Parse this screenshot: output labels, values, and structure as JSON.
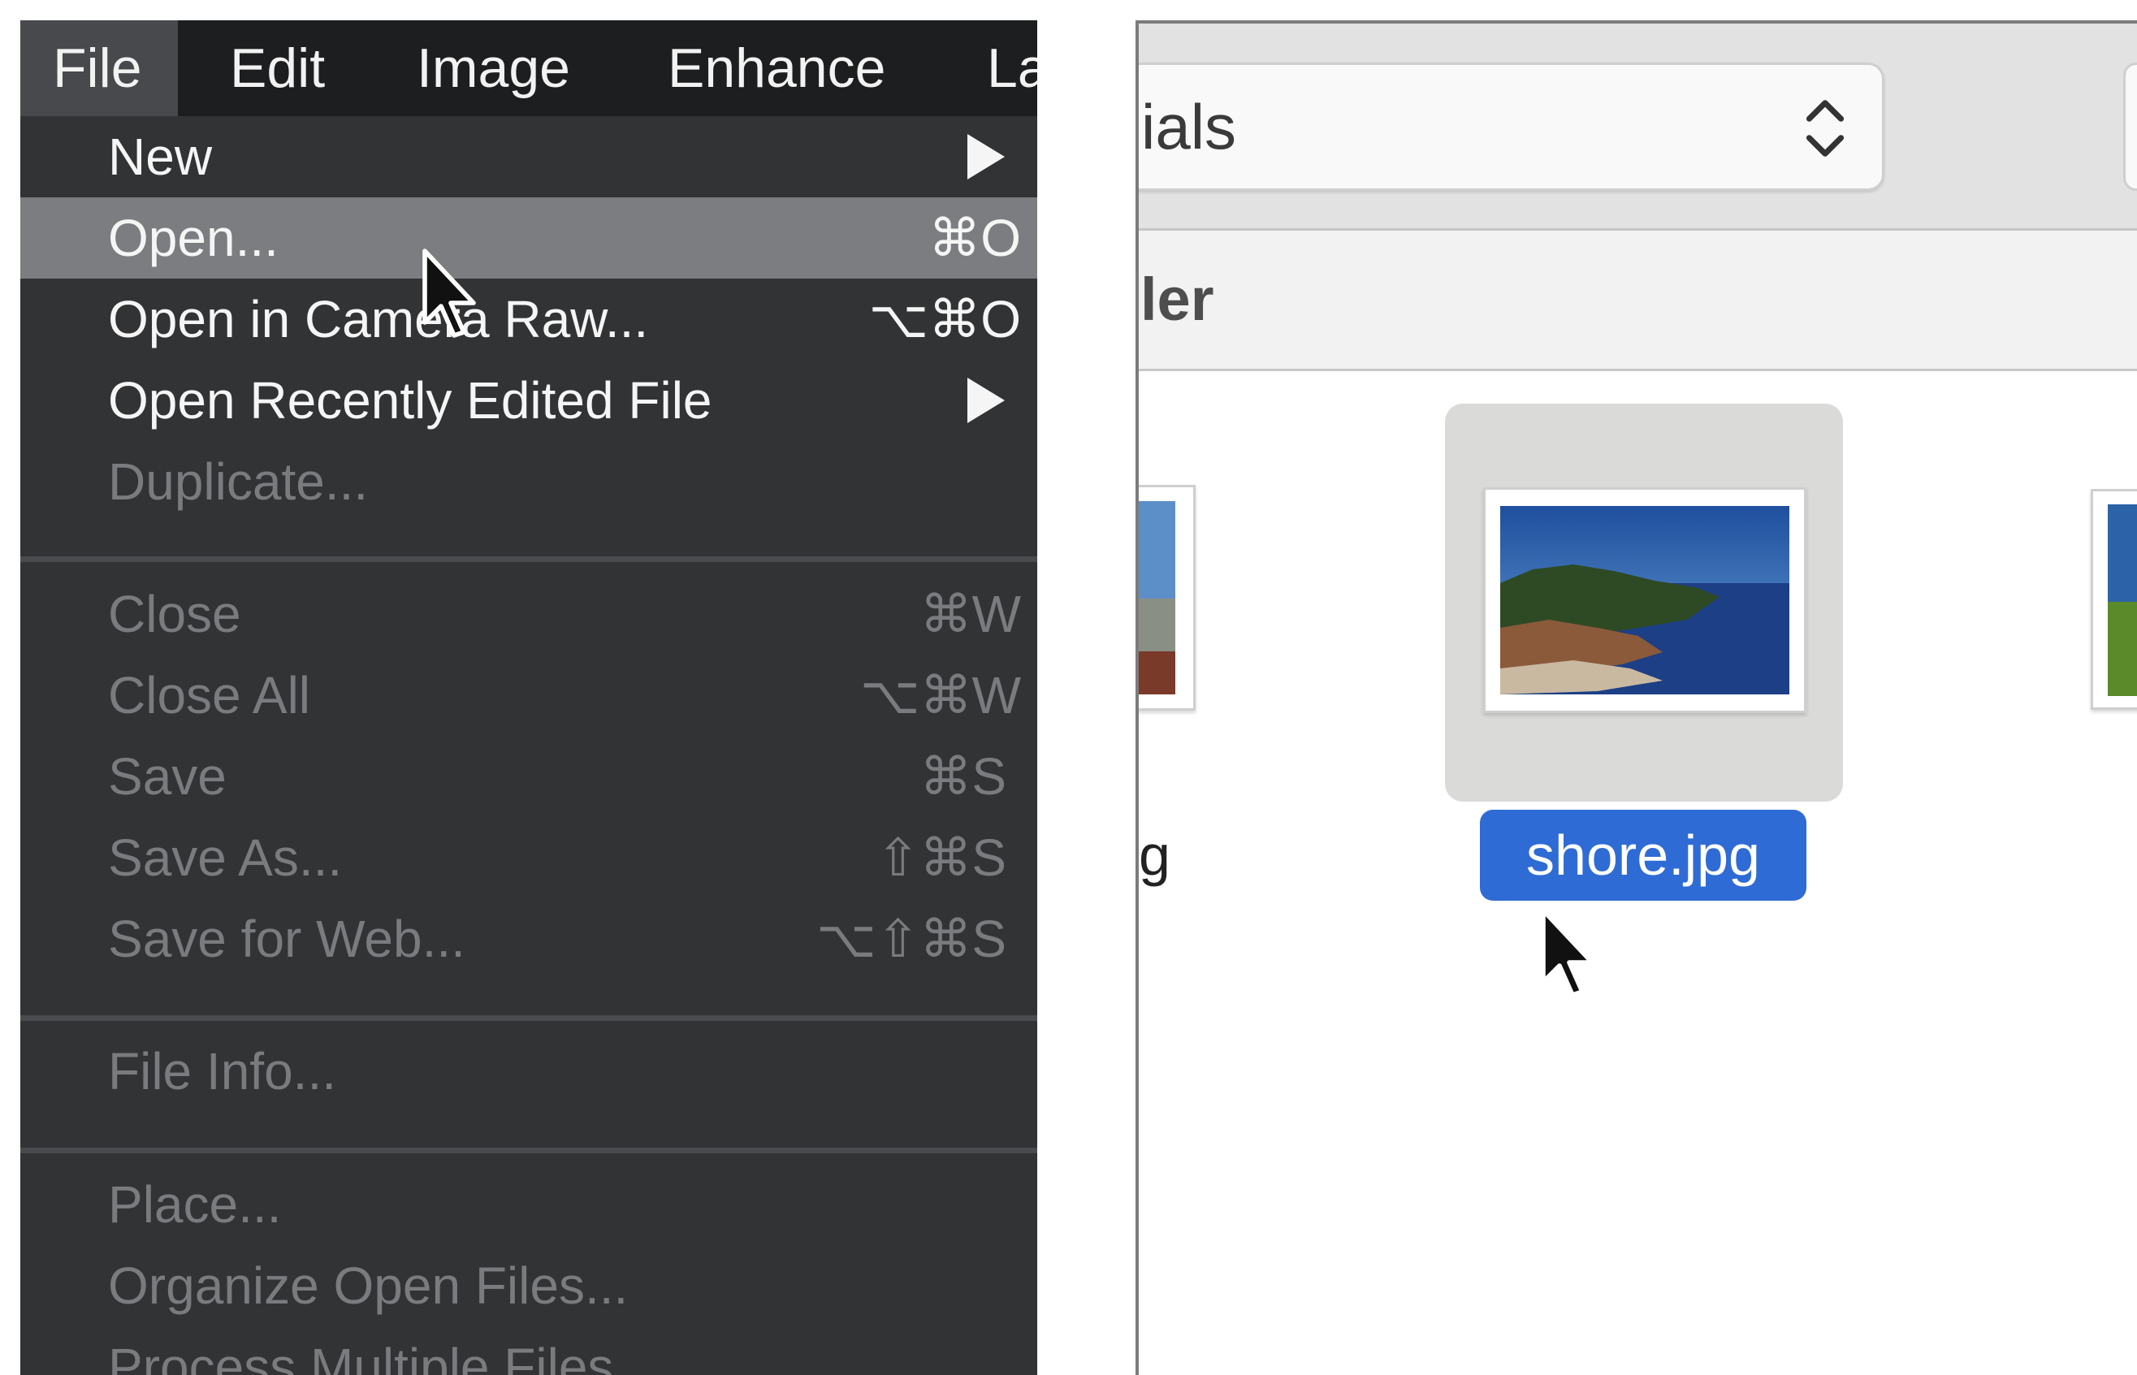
{
  "menubar": {
    "items": [
      "File",
      "Edit",
      "Image",
      "Enhance",
      "La"
    ],
    "active": "File"
  },
  "file_menu": {
    "items": [
      {
        "label": "New",
        "shortcut": "",
        "submenu": true,
        "enabled": true,
        "highlighted": false
      },
      {
        "label": "Open...",
        "shortcut": "⌘O",
        "submenu": false,
        "enabled": true,
        "highlighted": true
      },
      {
        "label": "Open in Camera Raw...",
        "shortcut": "⌥⌘O",
        "submenu": false,
        "enabled": true,
        "highlighted": false
      },
      {
        "label": "Open Recently Edited File",
        "shortcut": "",
        "submenu": true,
        "enabled": true,
        "highlighted": false
      },
      {
        "label": "Duplicate...",
        "shortcut": "",
        "submenu": false,
        "enabled": false,
        "highlighted": false
      },
      {
        "label": "Close",
        "shortcut": "⌘W",
        "submenu": false,
        "enabled": false,
        "highlighted": false
      },
      {
        "label": "Close All",
        "shortcut": "⌥⌘W",
        "submenu": false,
        "enabled": false,
        "highlighted": false
      },
      {
        "label": "Save",
        "shortcut": "⌘S",
        "submenu": false,
        "enabled": false,
        "highlighted": false
      },
      {
        "label": "Save As...",
        "shortcut": "⇧⌘S",
        "submenu": false,
        "enabled": false,
        "highlighted": false
      },
      {
        "label": "Save for Web...",
        "shortcut": "⌥⇧⌘S",
        "submenu": false,
        "enabled": false,
        "highlighted": false
      },
      {
        "label": "File Info...",
        "shortcut": "",
        "submenu": false,
        "enabled": false,
        "highlighted": false
      },
      {
        "label": "Place...",
        "shortcut": "",
        "submenu": false,
        "enabled": false,
        "highlighted": false
      },
      {
        "label": "Organize Open Files...",
        "shortcut": "",
        "submenu": false,
        "enabled": false,
        "highlighted": false
      },
      {
        "label": "Process Multiple Files...",
        "shortcut": "",
        "submenu": false,
        "enabled": false,
        "highlighted": false
      }
    ]
  },
  "dialog": {
    "location_popup": "ials",
    "column_header": "ler",
    "files": [
      {
        "name": "g",
        "selected": false
      },
      {
        "name": "shore.jpg",
        "selected": true
      },
      {
        "name": "",
        "selected": false
      }
    ]
  },
  "colors": {
    "menu_bg": "#323335",
    "menubar_bg": "#1d1e20",
    "menu_highlight": "#7b7d80",
    "selection_blue": "#2f6bd5"
  },
  "icons": [
    "submenu-arrow-icon",
    "pointer-cursor-icon",
    "up-down-chevron-icon"
  ]
}
